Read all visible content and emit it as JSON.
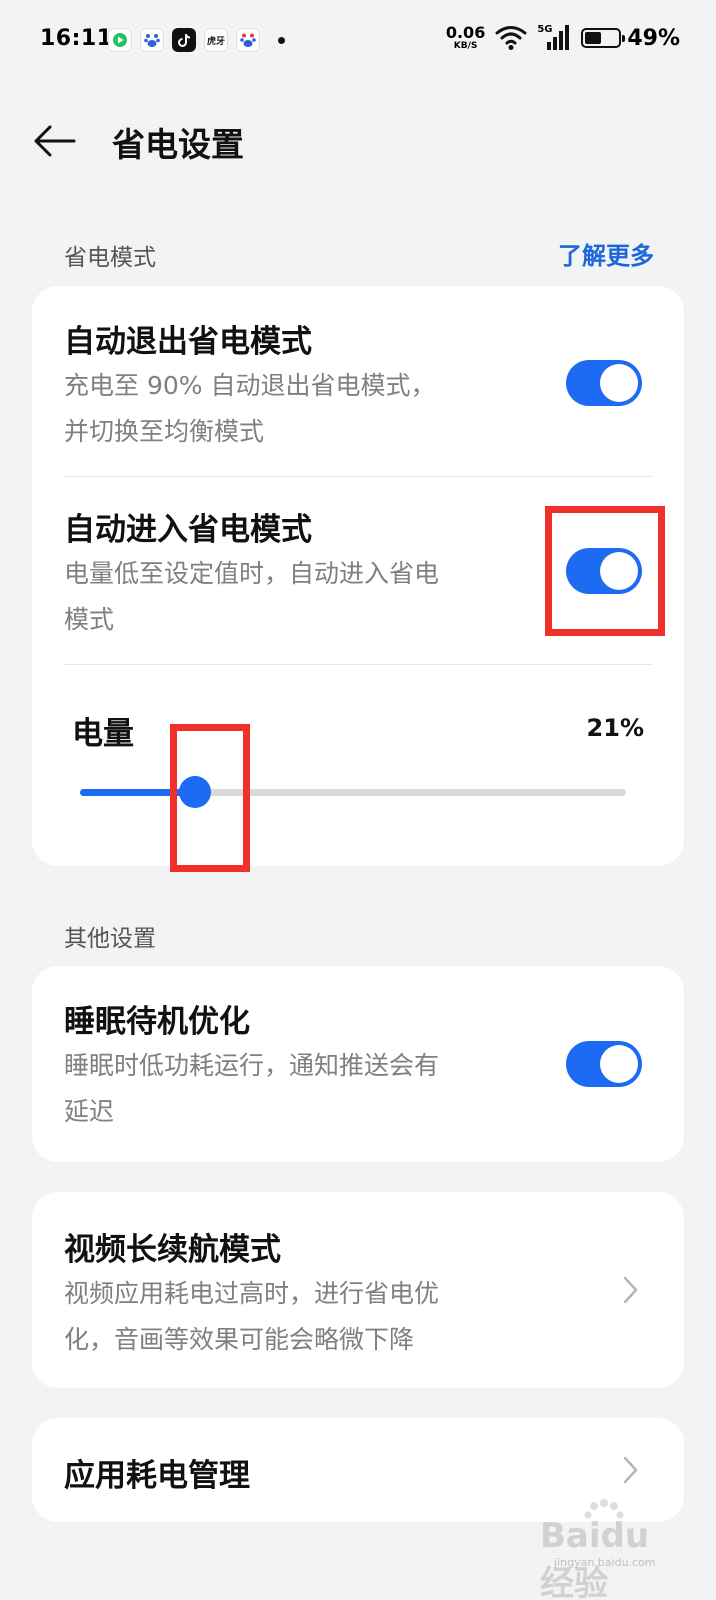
{
  "status_bar": {
    "time": "16:11",
    "net_speed_value": "0.06",
    "net_speed_unit": "KB/S",
    "signal_label": "5G",
    "battery_percent": "49%",
    "battery_level": 0.49,
    "app_icons": [
      "video-app-icon",
      "baidu-app-icon",
      "tiktok-app-icon",
      "huya-app-icon",
      "baidu-app-icon"
    ],
    "huya_label": "虎牙"
  },
  "header": {
    "title": "省电设置"
  },
  "power_saving": {
    "section_label": "省电模式",
    "learn_more": "了解更多",
    "auto_exit": {
      "title": "自动退出省电模式",
      "desc_line1": "充电至 90% 自动退出省电模式，",
      "desc_line2": "并切换至均衡模式",
      "enabled": true
    },
    "auto_enter": {
      "title": "自动进入省电模式",
      "desc_line1": "电量低至设定值时，自动进入省电",
      "desc_line2": "模式",
      "enabled": true
    },
    "battery_slider": {
      "label": "电量",
      "value_text": "21%",
      "value": 0.21
    }
  },
  "other_settings": {
    "section_label": "其他设置",
    "sleep_optimization": {
      "title": "睡眠待机优化",
      "desc_line1": "睡眠时低功耗运行，通知推送会有",
      "desc_line2": "延迟",
      "enabled": true
    },
    "video_mode": {
      "title": "视频长续航模式",
      "desc_line1": "视频应用耗电过高时，进行省电优",
      "desc_line2": "化，音画等效果可能会略微下降"
    },
    "app_power": {
      "title": "应用耗电管理"
    }
  },
  "colors": {
    "accent": "#1c6bf2",
    "link": "#1d67d8",
    "annotation": "#f2302a",
    "background": "#f1f3f5"
  },
  "watermark": {
    "text": "Baidu经验",
    "sub": "jingyan.baidu.com"
  }
}
